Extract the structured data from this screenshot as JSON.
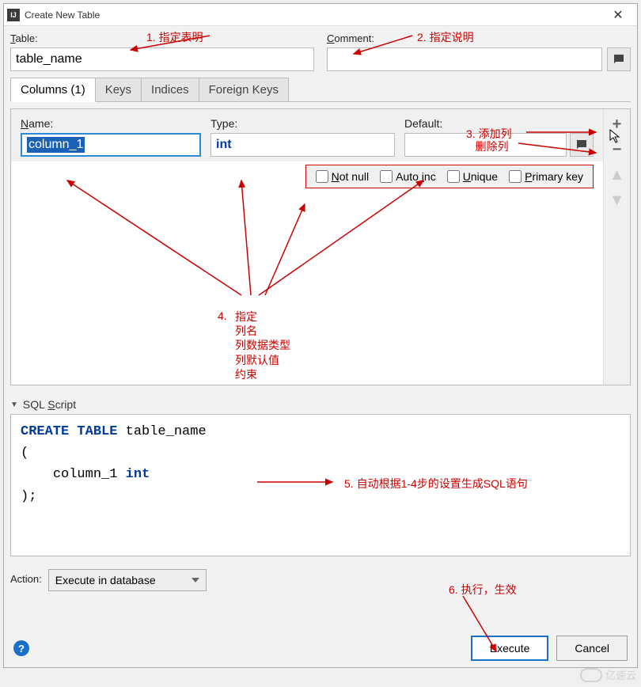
{
  "window": {
    "title": "Create New Table"
  },
  "labels": {
    "table": "Table:",
    "comment": "Comment:",
    "name": "Name:",
    "type": "Type:",
    "default": "Default:",
    "sql_script": "SQL Script",
    "action": "Action:"
  },
  "values": {
    "table_name": "table_name",
    "comment": "",
    "column_name": "column_1",
    "column_type": "int",
    "default": "",
    "action_selected": "Execute in database"
  },
  "tabs": [
    {
      "label": "Columns (1)",
      "active": true
    },
    {
      "label": "Keys",
      "active": false
    },
    {
      "label": "Indices",
      "active": false
    },
    {
      "label": "Foreign Keys",
      "active": false
    }
  ],
  "checkboxes": {
    "not_null": "Not null",
    "auto_inc": "Auto inc",
    "unique": "Unique",
    "primary_key": "Primary key"
  },
  "side_buttons": {
    "add": "+",
    "remove": "−",
    "up": "▲",
    "down": "▼"
  },
  "sql": {
    "line1_kw": "CREATE TABLE ",
    "line1_rest": "table_name",
    "line2": "(",
    "line3_indent": "    ",
    "line3_col": "column_1 ",
    "line3_type": "int",
    "line4": ");"
  },
  "buttons": {
    "execute": "Execute",
    "cancel": "Cancel"
  },
  "annotations": {
    "a1": "1. 指定表明",
    "a2": "2. 指定说明",
    "a3a": "3. 添加列",
    "a3b": "   删除列",
    "a4_num": "4.",
    "a4_t": "指定\n列名\n列数据类型\n列默认值\n约束",
    "a5": "5. 自动根据1-4步的设置生成SQL语句",
    "a6": "6. 执行，生效"
  },
  "watermark": "亿速云"
}
